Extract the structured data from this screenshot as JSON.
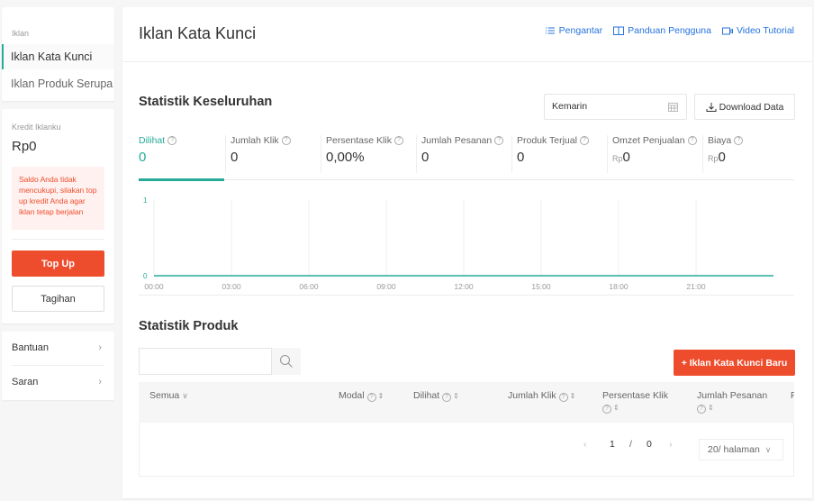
{
  "sidebar": {
    "section_label": "Iklan",
    "nav_items": [
      {
        "label": "Iklan Kata Kunci",
        "active": true
      },
      {
        "label": "Iklan Produk Serupa",
        "active": false
      }
    ],
    "credit": {
      "label": "Kredit Iklanku",
      "value": "Rp0",
      "warning": "Saldo Anda tidak mencukupi, silakan top up kredit Anda agar iklan tetap berjalan",
      "topup_label": "Top Up",
      "bill_label": "Tagihan"
    },
    "help_items": [
      {
        "label": "Bantuan"
      },
      {
        "label": "Saran"
      }
    ]
  },
  "header": {
    "title": "Iklan Kata Kunci",
    "links": [
      {
        "label": "Pengantar",
        "icon": "list-icon"
      },
      {
        "label": "Panduan Pengguna",
        "icon": "book-icon"
      },
      {
        "label": "Video Tutorial",
        "icon": "video-icon"
      }
    ]
  },
  "overall": {
    "title": "Statistik Keseluruhan",
    "date_range": "Kemarin",
    "download_label": "Download Data",
    "metrics": [
      {
        "label": "Dilihat",
        "value": "0",
        "prefix": "",
        "active": true
      },
      {
        "label": "Jumlah Klik",
        "value": "0",
        "prefix": ""
      },
      {
        "label": "Persentase Klik",
        "value": "0,00%",
        "prefix": ""
      },
      {
        "label": "Jumlah Pesanan",
        "value": "0",
        "prefix": ""
      },
      {
        "label": "Produk Terjual",
        "value": "0",
        "prefix": ""
      },
      {
        "label": "Omzet Penjualan",
        "value": "0",
        "prefix": "Rp"
      },
      {
        "label": "Biaya",
        "value": "0",
        "prefix": "Rp"
      }
    ]
  },
  "chart_data": {
    "type": "line",
    "title": "",
    "xlabel": "",
    "ylabel": "",
    "x": [
      "00:00",
      "03:00",
      "06:00",
      "09:00",
      "12:00",
      "15:00",
      "18:00",
      "21:00"
    ],
    "x_ticks": [
      "00:00",
      "03:00",
      "06:00",
      "09:00",
      "12:00",
      "15:00",
      "18:00",
      "21:00"
    ],
    "y_ticks": [
      "0",
      "1"
    ],
    "ylim": [
      0,
      1
    ],
    "grid": "vertical",
    "series": [
      {
        "name": "Dilihat",
        "values": [
          0,
          0,
          0,
          0,
          0,
          0,
          0,
          0
        ],
        "color": "#26aa99"
      }
    ]
  },
  "products": {
    "title": "Statistik Produk",
    "search_placeholder": "",
    "search_value": "",
    "new_button_label": "+ Iklan Kata Kunci Baru",
    "columns": [
      {
        "label": "Semua",
        "dropdown": true
      },
      {
        "label": "Modal",
        "help": true,
        "sortable": true
      },
      {
        "label": "Dilihat",
        "help": true,
        "sortable": true
      },
      {
        "label": "Jumlah Klik",
        "help": true,
        "sortable": true
      },
      {
        "label": "Persentase Klik",
        "help": true,
        "sortable": true
      },
      {
        "label": "Jumlah Pesanan",
        "help": true,
        "sortable": true
      },
      {
        "label": "P",
        "help": false,
        "sortable": false
      }
    ],
    "rows": [],
    "pagination": {
      "current": "1",
      "separator": "/",
      "total": "0",
      "page_size": "20/ halaman"
    }
  },
  "colors": {
    "accent": "#26aa99",
    "primary": "#ee4d2d",
    "link": "#2673dd"
  }
}
